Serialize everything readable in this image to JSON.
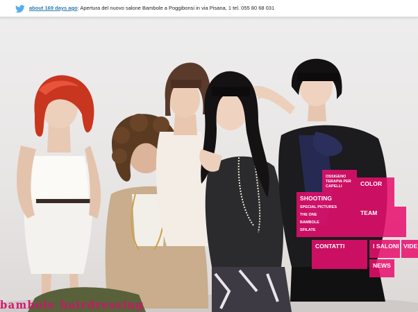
{
  "twitter": {
    "icon": "twitter-bird-icon",
    "time_link": "about 169 days ago",
    "message": ": Apertura del nuovo salone Bambole a Poggibonsi in via Pisana, 1 tel. 055 80 68 031"
  },
  "menu": {
    "ossigeno": "OSSIGENO TERAPIA PER CAPELLI",
    "color": "COLOR",
    "shooting": "SHOOTING",
    "shooting_items": [
      "SPECIAL PICTURES",
      "THE ONE",
      "BAMBOLE",
      "SFILATE"
    ],
    "team": "TEAM",
    "contatti": "CONTATTI",
    "saloni": "I SALONI",
    "video": "VIDE",
    "news": "NEWS"
  },
  "brand": "bambole hairdressing",
  "colors": {
    "accent": "#e80e6e",
    "link": "#2a7ab3"
  }
}
